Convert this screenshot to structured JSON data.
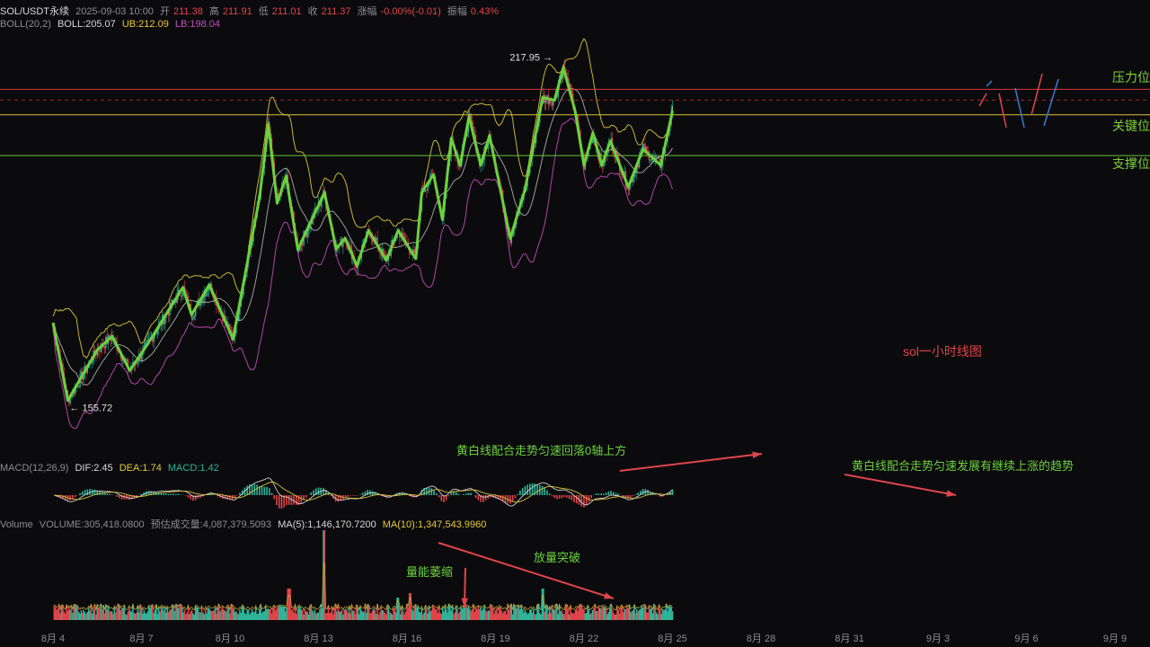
{
  "header": {
    "symbol": "SOL/USDT永续",
    "datetime": "2025-09-03 10:00",
    "open_label": "开",
    "open": "211.38",
    "high_label": "高",
    "high": "211.91",
    "low_label": "低",
    "low": "211.01",
    "close_label": "收",
    "close": "211.37",
    "change_label": "涨幅",
    "change": "-0.00%(-0.01)",
    "amp_label": "振幅",
    "amp": "0.43%"
  },
  "boll": {
    "name": "BOLL(20,2)",
    "mid": "BOLL:205.07",
    "ub": "UB:212.09",
    "lb": "LB:198.04"
  },
  "macd": {
    "name": "MACD(12,26,9)",
    "dif": "DIF:2.45",
    "dea": "DEA:1.74",
    "macd": "MACD:1.42"
  },
  "volume": {
    "name": "Volume",
    "vol": "VOLUME:305,418.0800",
    "est": "预估成交量:4,087,379.5093",
    "ma5": "MA(5):1,146,170.7200",
    "ma10": "MA(10):1,347,543.9960"
  },
  "levels": {
    "resistance": "压力位",
    "key": "关键位",
    "support": "支撑位"
  },
  "annotations": {
    "chart_title": "sol一小时线图",
    "macd_note_1": "黄白线配合走势匀速回落0轴上方",
    "macd_note_2": "黄白线配合走势匀速发展有继续上涨的趋势",
    "vol_shrink": "量能萎缩",
    "vol_breakout": "放量突破"
  },
  "colors": {
    "background": "#0b0b0d",
    "up": "#2fb59a",
    "down": "#e0454a",
    "zigzag": "#6bd13d",
    "boll_upper": "#c8b43a",
    "boll_mid": "#cfcfcf",
    "boll_lower": "#b046a8",
    "resistance": "#d9363e",
    "key": "#d9c13a",
    "support": "#5fc23a"
  },
  "chart_data": {
    "type": "candlestick",
    "x_ticks": [
      "8月 4",
      "8月 7",
      "8月 10",
      "8月 13",
      "8月 16",
      "8月 19",
      "8月 22",
      "8月 25",
      "8月 28",
      "8月 31",
      "9月 3",
      "9月 6",
      "9月 9"
    ],
    "y_range": [
      150,
      222
    ],
    "price_labels": {
      "max": "217.95",
      "min": "155.72"
    },
    "max_value": 217.95,
    "min_value": 155.72,
    "levels": {
      "resistance": 213.0,
      "key": 208.3,
      "support": 200.8
    },
    "zigzag": [
      [
        0.0,
        170.0
      ],
      [
        0.5,
        155.7
      ],
      [
        1.5,
        165.0
      ],
      [
        2.0,
        167.5
      ],
      [
        2.6,
        161.2
      ],
      [
        3.2,
        166.0
      ],
      [
        4.4,
        176.5
      ],
      [
        4.7,
        171.5
      ],
      [
        5.3,
        177.0
      ],
      [
        6.1,
        167.0
      ],
      [
        7.0,
        193.0
      ],
      [
        7.3,
        206.5
      ],
      [
        7.6,
        192.0
      ],
      [
        7.9,
        197.0
      ],
      [
        8.3,
        183.5
      ],
      [
        9.2,
        194.0
      ],
      [
        9.6,
        183.6
      ],
      [
        9.9,
        185.6
      ],
      [
        10.3,
        180.5
      ],
      [
        10.7,
        187.0
      ],
      [
        11.3,
        181.5
      ],
      [
        11.7,
        187.0
      ],
      [
        12.3,
        181.8
      ],
      [
        12.5,
        194.0
      ],
      [
        12.9,
        197.3
      ],
      [
        13.2,
        189.0
      ],
      [
        13.5,
        204.0
      ],
      [
        13.8,
        199.0
      ],
      [
        14.1,
        208.0
      ],
      [
        14.5,
        199.0
      ],
      [
        14.8,
        204.5
      ],
      [
        15.5,
        185.5
      ],
      [
        16.0,
        194.5
      ],
      [
        16.6,
        211.5
      ],
      [
        17.0,
        211.0
      ],
      [
        17.3,
        217.0
      ],
      [
        17.7,
        209.0
      ],
      [
        18.0,
        199.0
      ],
      [
        18.3,
        205.0
      ],
      [
        18.6,
        199.0
      ],
      [
        18.9,
        203.5
      ],
      [
        19.5,
        195.0
      ],
      [
        20.0,
        202.0
      ],
      [
        20.6,
        199.0
      ],
      [
        21.0,
        209.0
      ]
    ],
    "series": [
      {
        "name": "UB",
        "value": 212.09
      },
      {
        "name": "BOLL",
        "value": 205.07
      },
      {
        "name": "LB",
        "value": 198.04
      }
    ],
    "macd": {
      "dif": 2.45,
      "dea": 1.74,
      "macd": 1.42
    },
    "volume": {
      "spikes": [
        [
          9.2,
          1.0
        ],
        [
          8.0,
          0.35
        ],
        [
          16.6,
          0.35
        ],
        [
          11.7,
          0.25
        ],
        [
          12.1,
          0.3
        ]
      ]
    }
  }
}
